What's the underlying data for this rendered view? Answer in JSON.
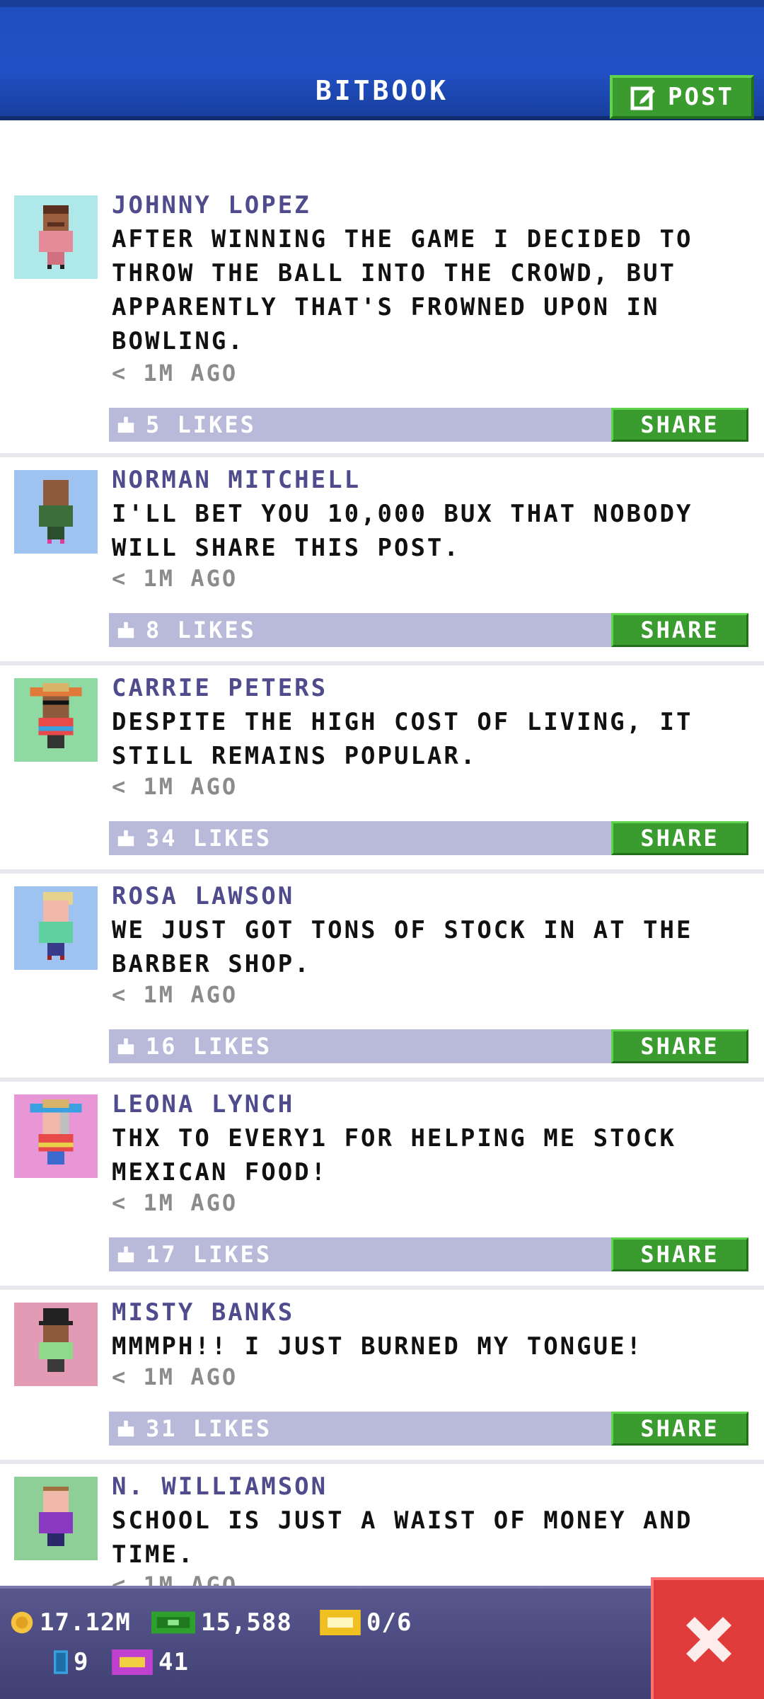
{
  "header": {
    "title": "BITBOOK",
    "post_label": "POST"
  },
  "posts": [
    {
      "author": "JOHNNY LOPEZ",
      "text": "AFTER WINNING THE GAME I DECIDED TO THROW THE BALL INTO THE CROWD, BUT APPARENTLY THAT'S FROWNED UPON IN BOWLING.",
      "time": "< 1M AGO",
      "likes": "5 LIKES",
      "share": "SHARE",
      "avatar_bg": "#aee8e8"
    },
    {
      "author": "NORMAN MITCHELL",
      "text": "I'LL BET YOU 10,000 BUX THAT NOBODY WILL SHARE THIS POST.",
      "time": "< 1M AGO",
      "likes": "8 LIKES",
      "share": "SHARE",
      "avatar_bg": "#9ec3f0"
    },
    {
      "author": "CARRIE PETERS",
      "text": "DESPITE THE HIGH COST OF LIVING, IT STILL REMAINS POPULAR.",
      "time": "< 1M AGO",
      "likes": "34 LIKES",
      "share": "SHARE",
      "avatar_bg": "#8fd9a3"
    },
    {
      "author": "ROSA LAWSON",
      "text": "WE JUST GOT TONS OF STOCK IN AT THE BARBER SHOP.",
      "time": "< 1M AGO",
      "likes": "16 LIKES",
      "share": "SHARE",
      "avatar_bg": "#9ec3f0"
    },
    {
      "author": "LEONA LYNCH",
      "text": "THX TO EVERY1 FOR HELPING ME STOCK MEXICAN FOOD!",
      "time": "< 1M AGO",
      "likes": "17 LIKES",
      "share": "SHARE",
      "avatar_bg": "#e896d6"
    },
    {
      "author": "MISTY BANKS",
      "text": "MMMPH!! I JUST BURNED MY TONGUE!",
      "time": "< 1M AGO",
      "likes": "31 LIKES",
      "share": "SHARE",
      "avatar_bg": "#e39ab5"
    },
    {
      "author": "N. WILLIAMSON",
      "text": "SCHOOL IS JUST A WAIST OF MONEY AND TIME.",
      "time": "< 1M AGO",
      "likes": "",
      "share": "",
      "avatar_bg": "#8ecf97"
    }
  ],
  "footer": {
    "coins": "17.12M",
    "bux": "15,588",
    "tickets": "0/6",
    "elevators": "9",
    "vip": "41"
  },
  "colors": {
    "header_blue": "#2150c4",
    "green": "#3a9b2f",
    "footer": "#4a4a80",
    "close_red": "#e03c3c"
  }
}
